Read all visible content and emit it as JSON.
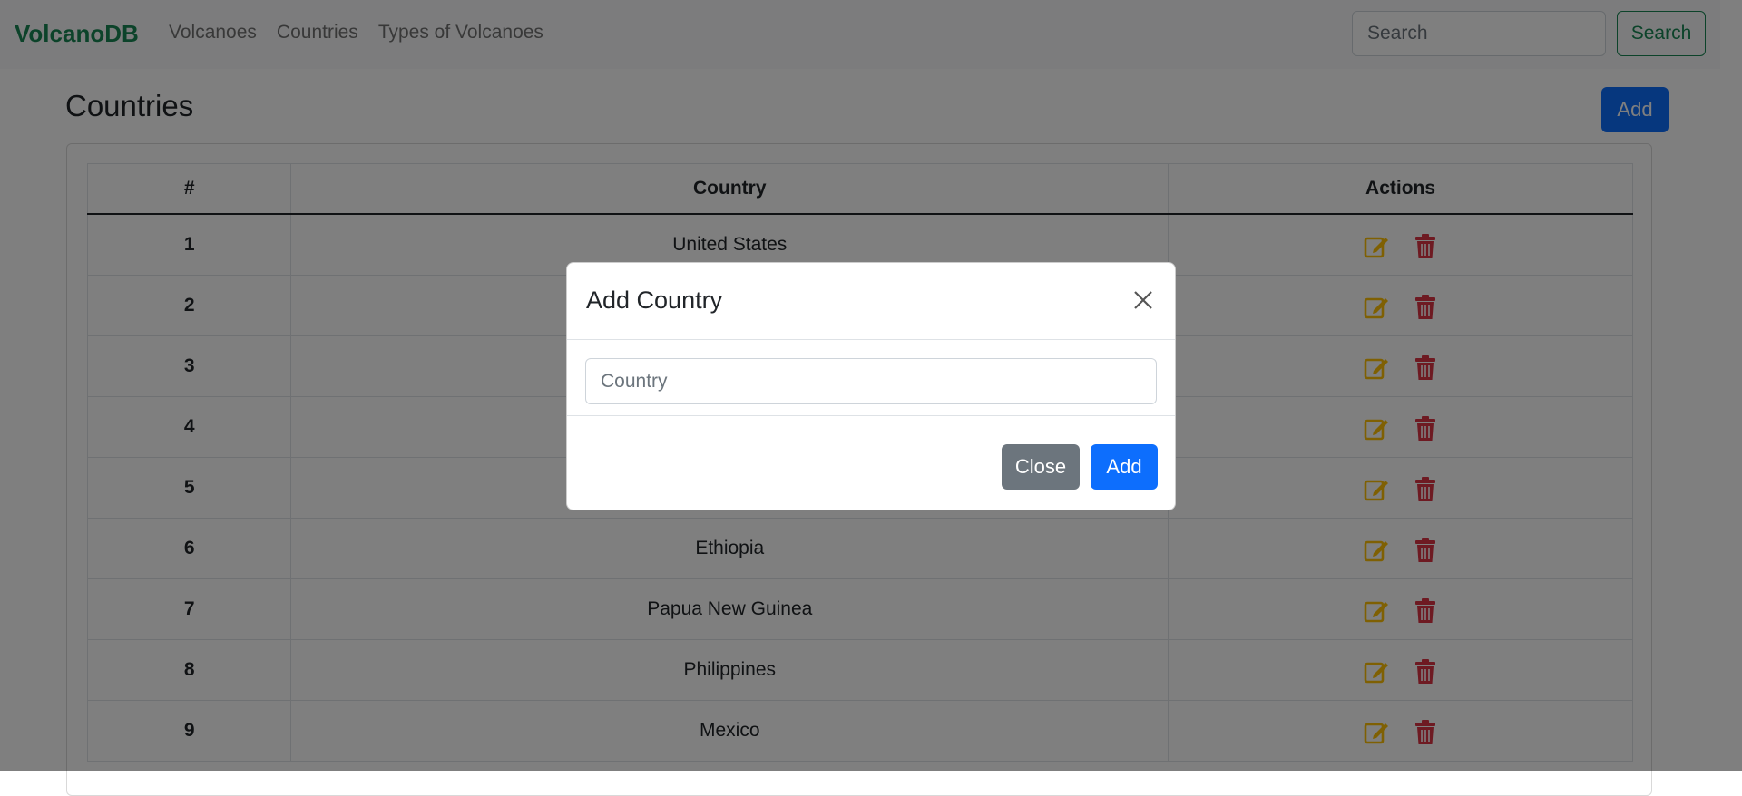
{
  "navbar": {
    "brand": "VolcanoDB",
    "links": [
      "Volcanoes",
      "Countries",
      "Types of Volcanoes"
    ],
    "search_placeholder": "Search",
    "search_button": "Search"
  },
  "page": {
    "title": "Countries",
    "add_button": "Add"
  },
  "table": {
    "headers": [
      "#",
      "Country",
      "Actions"
    ],
    "rows": [
      {
        "num": "1",
        "country": "United States"
      },
      {
        "num": "2",
        "country": ""
      },
      {
        "num": "3",
        "country": ""
      },
      {
        "num": "4",
        "country": ""
      },
      {
        "num": "5",
        "country": ""
      },
      {
        "num": "6",
        "country": "Ethiopia"
      },
      {
        "num": "7",
        "country": "Papua New Guinea"
      },
      {
        "num": "8",
        "country": "Philippines"
      },
      {
        "num": "9",
        "country": "Mexico"
      }
    ],
    "action_icons": [
      "edit-icon",
      "trash-icon"
    ]
  },
  "modal": {
    "title": "Add Country",
    "input_placeholder": "Country",
    "close_button": "Close",
    "add_button": "Add"
  },
  "colors": {
    "brand": "#198754",
    "primary": "#0d6efd",
    "secondary": "#6c757d",
    "edit": "#ffc107",
    "delete": "#dc3545",
    "overlay": "rgba(0,0,0,0.5)"
  }
}
